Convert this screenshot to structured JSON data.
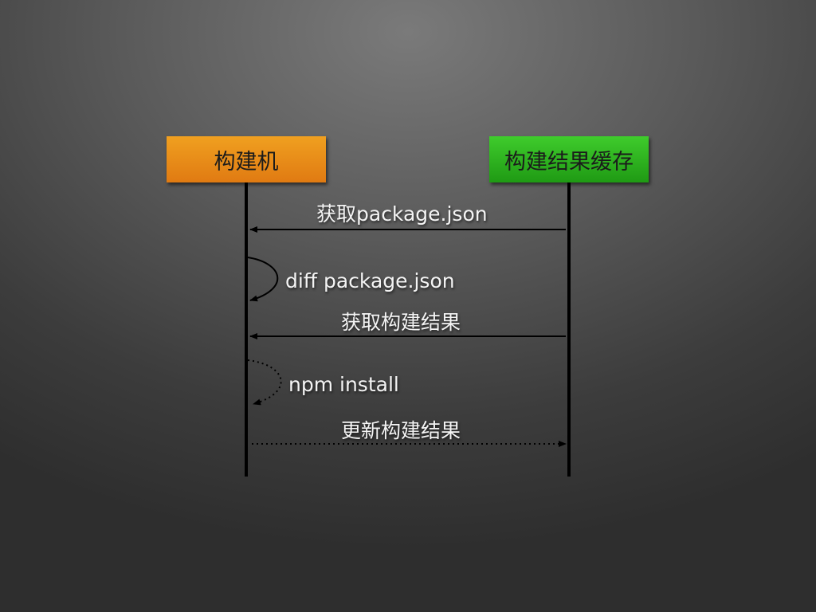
{
  "actors": {
    "builder": "构建机",
    "cache": "构建结果缓存"
  },
  "messages": [
    {
      "label": "获取package.json",
      "from": "cache",
      "to": "builder",
      "style": "solid"
    },
    {
      "label": "diff package.json",
      "from": "builder",
      "to": "builder",
      "style": "solid"
    },
    {
      "label": "获取构建结果",
      "from": "cache",
      "to": "builder",
      "style": "solid"
    },
    {
      "label": "npm install",
      "from": "builder",
      "to": "builder",
      "style": "dotted"
    },
    {
      "label": "更新构建结果",
      "from": "builder",
      "to": "cache",
      "style": "dotted"
    }
  ],
  "colors": {
    "builder_box": "#e88a18",
    "cache_box": "#2aaa1c",
    "lifeline": "#000000",
    "label_text": "#f4f4f4"
  }
}
